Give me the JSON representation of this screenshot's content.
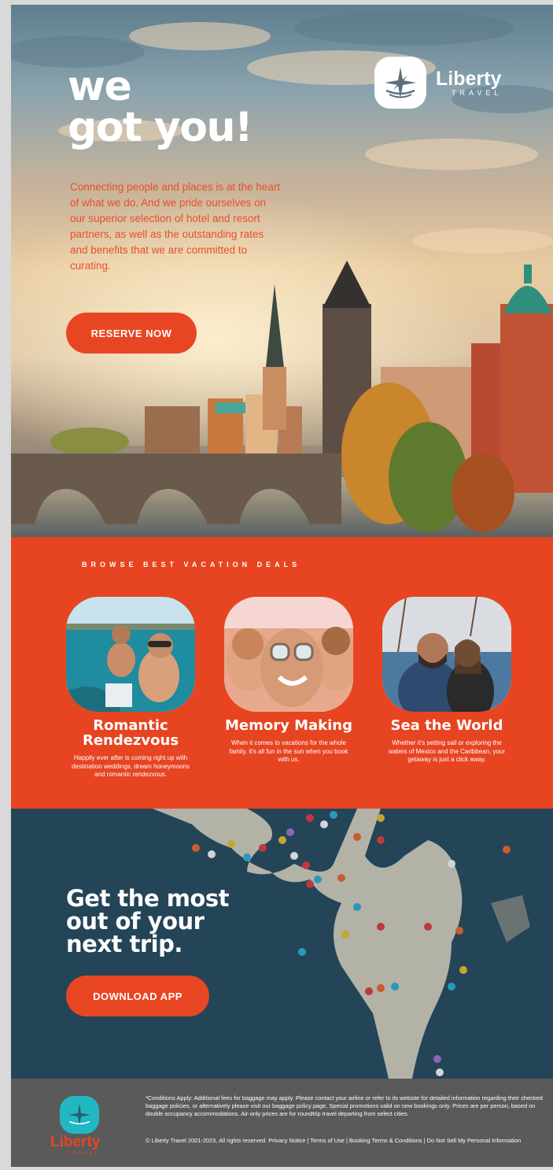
{
  "brand": {
    "name": "Liberty",
    "sub": "TRAVEL",
    "accent": "#e84622",
    "teal": "#21b8c4",
    "logo_icon": "compass-star-icon"
  },
  "hero": {
    "title_line1": "we",
    "title_line2": "got you!",
    "body": "Connecting people and places is at the heart of what we do. And we pride ourselves on our superior selection of hotel and resort partners, as well as the outstanding rates and benefits that we are committed to curating.",
    "cta": "RESERVE NOW"
  },
  "deals": {
    "heading": "BROWSE BEST VACATION DEALS",
    "items": [
      {
        "title": "Romantic Rendezvous",
        "desc": "Happily ever after is coming right up with destination weddings, dream honeymoons and romantic rendezvous."
      },
      {
        "title": "Memory Making",
        "desc": "When it comes to vacations for the whole family, it's all fun in the sun when you book with us."
      },
      {
        "title": "Sea the World",
        "desc": "Whether it's setting sail or exploring the waters of Mexico and the Caribbean, your getaway is just a click away."
      }
    ]
  },
  "app": {
    "title_line1": "Get the most",
    "title_line2": "out of your",
    "title_line3": "next trip.",
    "cta": "DOWNLOAD APP"
  },
  "footer": {
    "disclaimer": "*Conditions Apply: Additional fees for baggage may apply. Please contact your airline or refer to its website for detailed information regarding their checked baggage policies, or alternatively please visit our baggage policy page. Special promotions valid on new bookings only. Prices are per person, based on double occupancy accommodations. Air-only prices are for roundtrip travel departing from select cities.",
    "copyright": "© Liberty Travel 2001-2023, All rights reserved.",
    "privacy": "Privacy Notice",
    "terms": "Terms of Use",
    "booking": "Booking Terms & Conditions",
    "dnsmpi": "Do Not Sell My Personal Information"
  }
}
